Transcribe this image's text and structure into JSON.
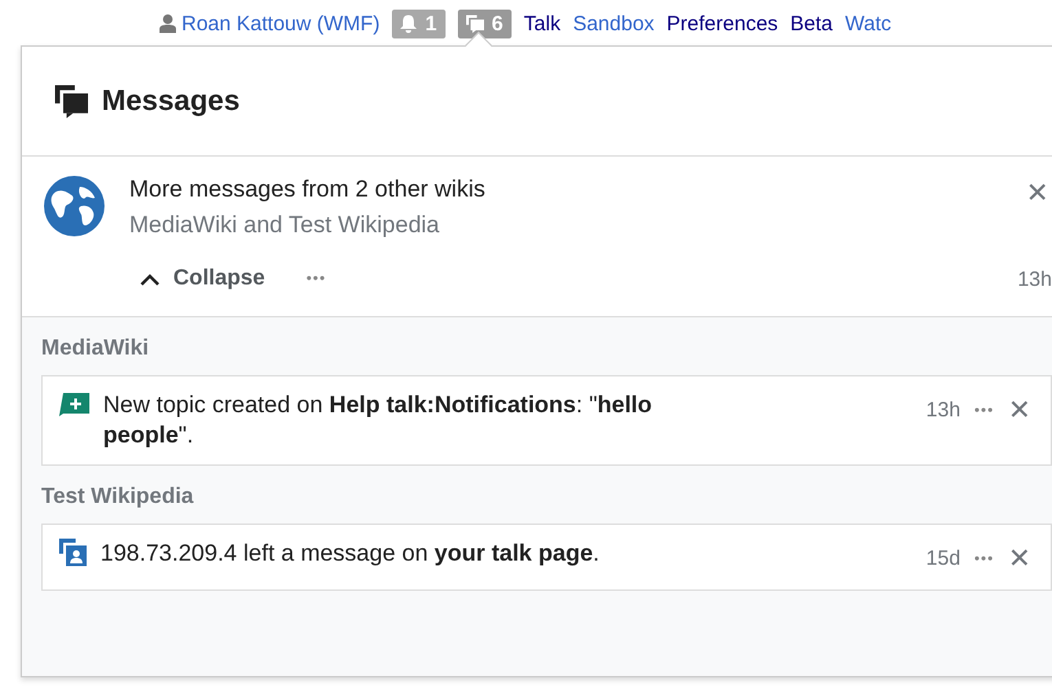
{
  "personal_bar": {
    "user": "Roan Kattouw (WMF)",
    "badges": [
      {
        "kind": "alerts",
        "count": "1",
        "selected": false
      },
      {
        "kind": "messages",
        "count": "6",
        "selected": true
      }
    ],
    "links": [
      {
        "label": "Talk",
        "visited": true
      },
      {
        "label": "Sandbox",
        "visited": false
      },
      {
        "label": "Preferences",
        "visited": true
      },
      {
        "label": "Beta",
        "visited": true
      },
      {
        "label": "Watc",
        "visited": false
      }
    ]
  },
  "popup": {
    "title": "Messages",
    "bundle": {
      "title": "More messages from 2 other wikis",
      "subtitle": "MediaWiki and Test Wikipedia",
      "toggle": "Collapse",
      "more": "•••",
      "time": "13h",
      "close": "✕"
    },
    "groups": [
      {
        "wiki": "MediaWiki",
        "items": [
          {
            "kind": "new-topic",
            "text": "New topic created on **Help talk:Notifications**: \"**hello people**\".",
            "time": "13h",
            "more": "•••",
            "close": "✕"
          }
        ]
      },
      {
        "wiki": "Test Wikipedia",
        "items": [
          {
            "kind": "talk",
            "text": "198.73.209.4 left a message on **your talk page**.",
            "time": "15d",
            "more": "•••",
            "close": "✕"
          }
        ]
      }
    ]
  }
}
